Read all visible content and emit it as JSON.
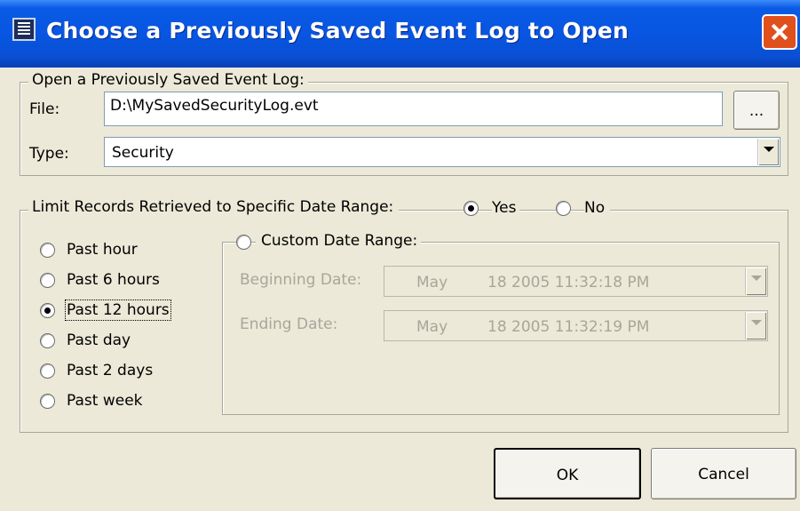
{
  "window": {
    "title": "Choose a Previously Saved Event Log to Open",
    "icon": "event-log-icon",
    "close_icon": "close-icon"
  },
  "open_group": {
    "legend": "Open a Previously Saved Event Log:",
    "file_label": "File:",
    "file_value": "D:\\MySavedSecurityLog.evt",
    "browse_label": "...",
    "type_label": "Type:",
    "type_value": "Security"
  },
  "limit_group": {
    "legend": "Limit Records Retrieved to Specific Date Range:",
    "yes_label": "Yes",
    "no_label": "No",
    "selected": "Yes",
    "options": [
      {
        "label": "Past hour",
        "checked": false
      },
      {
        "label": "Past 6 hours",
        "checked": false
      },
      {
        "label": "Past 12 hours",
        "checked": true
      },
      {
        "label": "Past day",
        "checked": false
      },
      {
        "label": "Past 2 days",
        "checked": false
      },
      {
        "label": "Past week",
        "checked": false
      }
    ],
    "custom": {
      "label": "Custom Date Range:",
      "checked": false,
      "beginning_label": "Beginning Date:",
      "beginning_month": "May",
      "beginning_value": "18 2005 11:32:18 PM",
      "ending_label": "Ending Date:",
      "ending_month": "May",
      "ending_value": "18 2005 11:32:19 PM"
    }
  },
  "buttons": {
    "ok": "OK",
    "cancel": "Cancel"
  },
  "colors": {
    "titlebar": "#0755e0",
    "dialog_bg": "#ece9d8",
    "close_button": "#e0501d"
  }
}
